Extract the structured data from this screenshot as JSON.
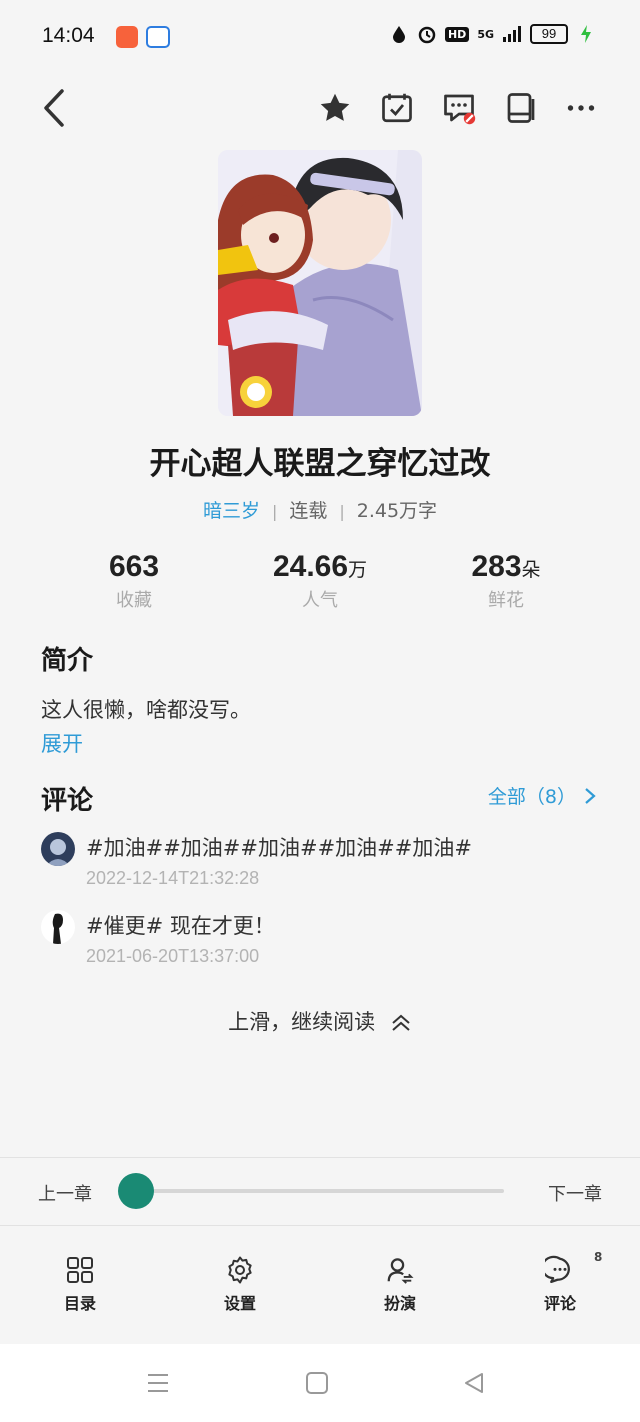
{
  "status_bar": {
    "time": "14:04",
    "hd_label": "HD",
    "network_label": "5G",
    "battery": "99"
  },
  "book": {
    "title": "开心超人联盟之穿忆过改",
    "author": "暗三岁",
    "status": "连载",
    "word_count": "2.45万字"
  },
  "stats": [
    {
      "value": "663",
      "unit": "",
      "label": "收藏"
    },
    {
      "value": "24.66",
      "unit": "万",
      "label": "人气"
    },
    {
      "value": "283",
      "unit": "朵",
      "label": "鲜花"
    }
  ],
  "intro": {
    "heading": "简介",
    "text": "这人很懒，啥都没写。",
    "expand": "展开"
  },
  "comments": {
    "heading": "评论",
    "see_all": "全部（8）",
    "items": [
      {
        "text": "#加油##加油##加油##加油##加油#",
        "time": "2022-12-14T21:32:28"
      },
      {
        "text": "#催更# 现在才更！",
        "time": "2021-06-20T13:37:00"
      }
    ]
  },
  "continue_reading": "上滑，继续阅读",
  "chapter_nav": {
    "prev": "上一章",
    "next": "下一章",
    "progress": 0.0
  },
  "bottom_nav": {
    "items": [
      {
        "label": "目录",
        "icon": "grid-icon"
      },
      {
        "label": "设置",
        "icon": "gear-icon"
      },
      {
        "label": "扮演",
        "icon": "roleplay-icon"
      },
      {
        "label": "评论",
        "icon": "comment-icon"
      }
    ],
    "comment_badge": "8"
  },
  "colors": {
    "accent": "#2f9bd6",
    "slider": "#1a8a74"
  }
}
